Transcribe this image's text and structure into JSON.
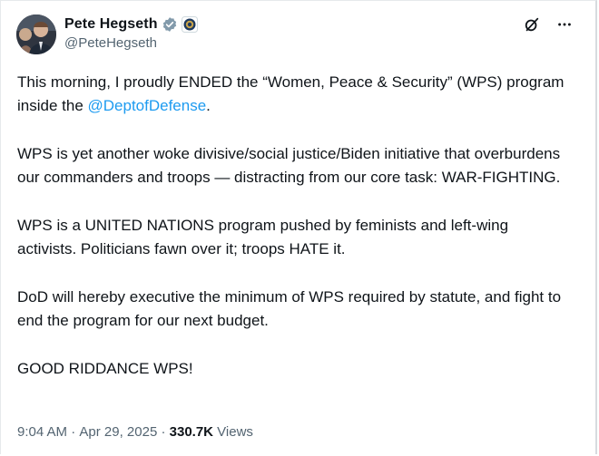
{
  "author": {
    "display_name": "Pete Hegseth",
    "handle": "@PeteHegseth",
    "avatar_icon": "avatar-photo",
    "verified_badge_icon": "verified-badge-icon",
    "affiliation_badge_icon": "dod-seal-icon",
    "verified_color": "#829aab"
  },
  "actions": {
    "grok_icon": "grok-icon",
    "more_icon": "more-horizontal-icon"
  },
  "tweet": {
    "p1_prefix": "This morning, I proudly ENDED the “Women, Peace & Security” (WPS) program inside the ",
    "p1_mention": "@DeptofDefense",
    "p1_suffix": ".",
    "p2": "WPS is yet another woke divisive/social justice/Biden initiative that overburdens our commanders and troops — distracting from our core task: WAR-FIGHTING.",
    "p3": "WPS is a UNITED NATIONS program pushed by feminists and left-wing activists. Politicians fawn over it; troops HATE it.",
    "p4": "DoD will hereby executive the minimum of WPS required by statute, and fight to end the program for our next budget.",
    "p5": "GOOD RIDDANCE WPS!"
  },
  "meta": {
    "time": "9:04 AM",
    "separator": " · ",
    "date": "Apr 29, 2025",
    "views_count": "330.7K",
    "views_label": " Views"
  },
  "colors": {
    "text": "#0f1419",
    "secondary": "#536471",
    "link": "#1d9bf0"
  }
}
